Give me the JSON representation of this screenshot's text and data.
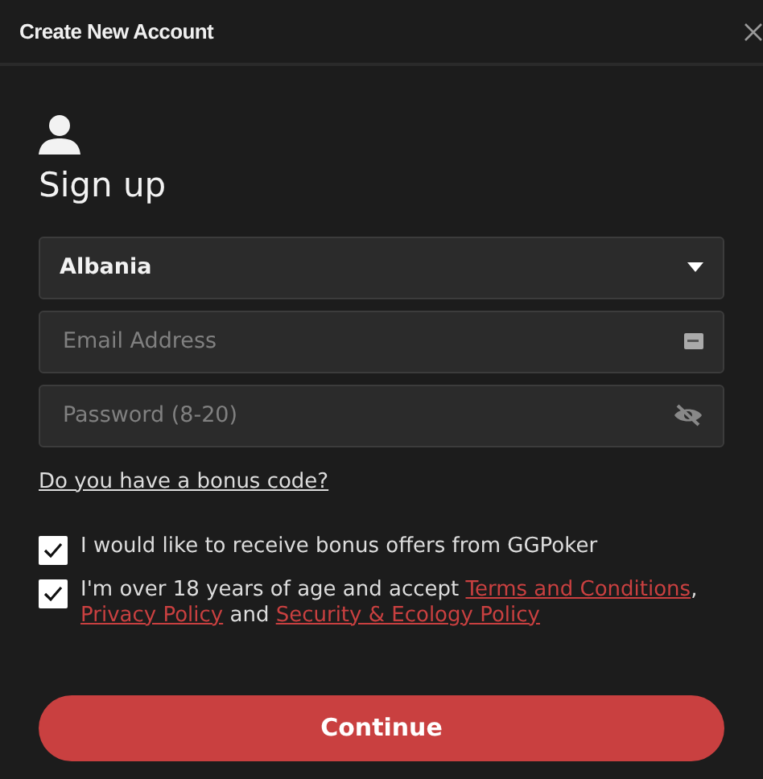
{
  "window": {
    "title": "Create New Account"
  },
  "heading": "Sign up",
  "country": {
    "value": "Albania"
  },
  "email": {
    "placeholder": "Email Address"
  },
  "password": {
    "placeholder": "Password (8-20)"
  },
  "bonus_link": "Do you have a bonus code?",
  "consents": [
    {
      "checked": true,
      "parts": [
        {
          "kind": "text",
          "text": "I would like to receive bonus offers from GGPoker"
        }
      ]
    },
    {
      "checked": true,
      "parts": [
        {
          "kind": "text",
          "text": "I'm over 18 years of age and accept "
        },
        {
          "kind": "link",
          "text": "Terms and Conditions"
        },
        {
          "kind": "text",
          "text": ", "
        },
        {
          "kind": "link",
          "text": "Privacy Policy"
        },
        {
          "kind": "text",
          "text": " and "
        },
        {
          "kind": "link",
          "text": "Security & Ecology Policy"
        }
      ]
    }
  ],
  "continue_button": "Continue"
}
